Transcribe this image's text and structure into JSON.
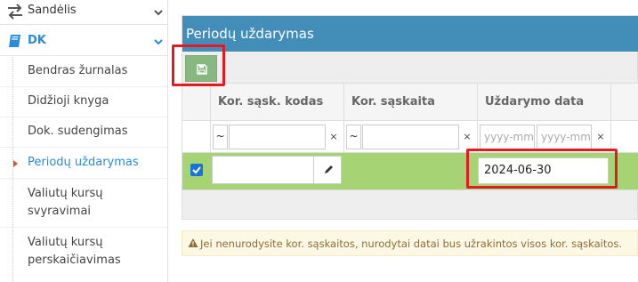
{
  "sidebar": {
    "top_item": {
      "label": "Sandėlis",
      "icon": "exchange-icon"
    },
    "dk": {
      "label": "DK",
      "icon": "book-icon",
      "color": "#2a8cd6"
    },
    "items": [
      {
        "label": "Bendras žurnalas"
      },
      {
        "label": "Didžioji knyga"
      },
      {
        "label": "Dok. sudengimas"
      },
      {
        "label": "Periodų uždarymas",
        "active": true
      },
      {
        "label_line1": "Valiutų kursų",
        "label_line2": "svyravimai"
      },
      {
        "label_line1": "Valiutų kursų",
        "label_line2": "perskaičiavimas"
      }
    ]
  },
  "panel": {
    "title": "Periodų uždarymas",
    "header_color": "#438eb9",
    "save_icon": "floppy-disk-icon"
  },
  "grid": {
    "columns": [
      {
        "label": "Kor. sąsk. kodas"
      },
      {
        "label": "Kor. sąskaita"
      },
      {
        "label": "Uždarymo data"
      }
    ],
    "filters": {
      "tilde": "~",
      "clear": "×",
      "date_from_placeholder": "yyyy-mm",
      "date_to_placeholder": "yyyy-mm"
    },
    "rows": [
      {
        "checked": true,
        "kor_sask_kodas": "",
        "kor_saskaita": "",
        "uzdarymo_data": "2024-06-30"
      }
    ],
    "selected_row_color": "#a6d474"
  },
  "alert": {
    "icon": "warning-icon",
    "text": "Jei nenurodysite kor. sąskaitos, nurodytai datai bus užrakintos visos kor. sąskaitos."
  }
}
